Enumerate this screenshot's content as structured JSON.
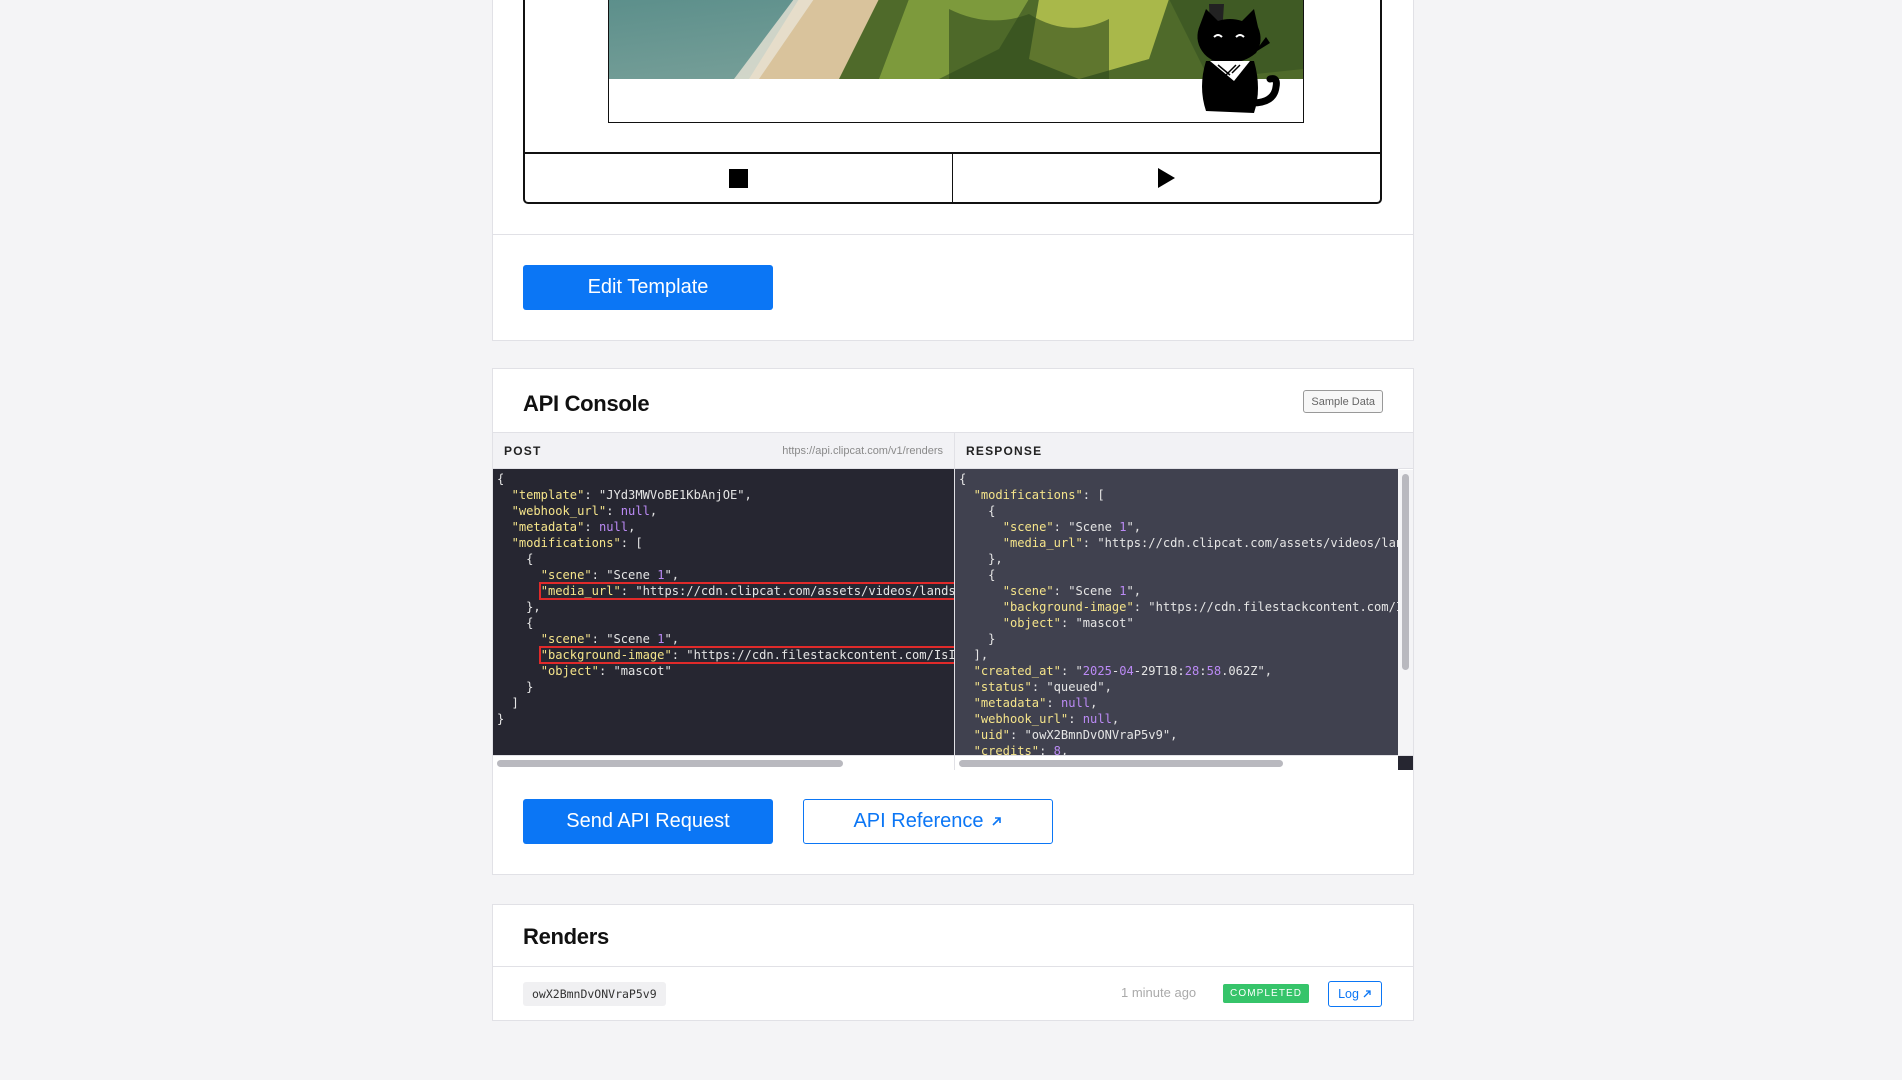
{
  "preview": {
    "stop_icon": "stop-icon",
    "play_icon": "play-icon",
    "edit_button": "Edit Template"
  },
  "api_console": {
    "title": "API Console",
    "sample_button": "Sample Data",
    "post_label": "POST",
    "endpoint_url": "https://api.clipcat.com/v1/renders",
    "response_label": "RESPONSE",
    "request_lines": [
      "{",
      "  \"template\": \"JYd3MWVoBE1KbAnjOE\",",
      "  \"webhook_url\": null,",
      "  \"metadata\": null,",
      "  \"modifications\": [",
      "    {",
      "      \"scene\": \"Scene 1\",",
      "      \"media_url\": \"https://cdn.clipcat.com/assets/videos/lands",
      "    },",
      "    {",
      "      \"scene\": \"Scene 1\",",
      "      \"background-image\": \"https://cdn.filestackcontent.com/IsI",
      "      \"object\": \"mascot\"",
      "    }",
      "  ]",
      "}"
    ],
    "response_lines": [
      "{",
      "  \"modifications\": [",
      "    {",
      "      \"scene\": \"Scene 1\",",
      "      \"media_url\": \"https://cdn.clipcat.com/assets/videos/lan",
      "    },",
      "    {",
      "      \"scene\": \"Scene 1\",",
      "      \"background-image\": \"https://cdn.filestackcontent.com/I",
      "      \"object\": \"mascot\"",
      "    }",
      "  ],",
      "  \"created_at\": \"2025-04-29T18:28:58.062Z\",",
      "  \"status\": \"queued\",",
      "  \"metadata\": null,",
      "  \"webhook_url\": null,",
      "  \"uid\": \"owX2BmnDvONVraP5v9\",",
      "  \"credits\": 8,"
    ],
    "send_button": "Send API Request",
    "reference_button": "API Reference",
    "external_icon": "external-link-icon"
  },
  "renders": {
    "title": "Renders",
    "items": [
      {
        "uid": "owX2BmnDvONVraP5v9",
        "time": "1 minute ago",
        "status": "COMPLETED",
        "log_label": "Log"
      }
    ]
  },
  "colors": {
    "primary": "#0b76f5",
    "success": "#36c46a",
    "highlight": "#e02a2a",
    "code_bg": "#262631",
    "response_bg": "#40414f"
  }
}
